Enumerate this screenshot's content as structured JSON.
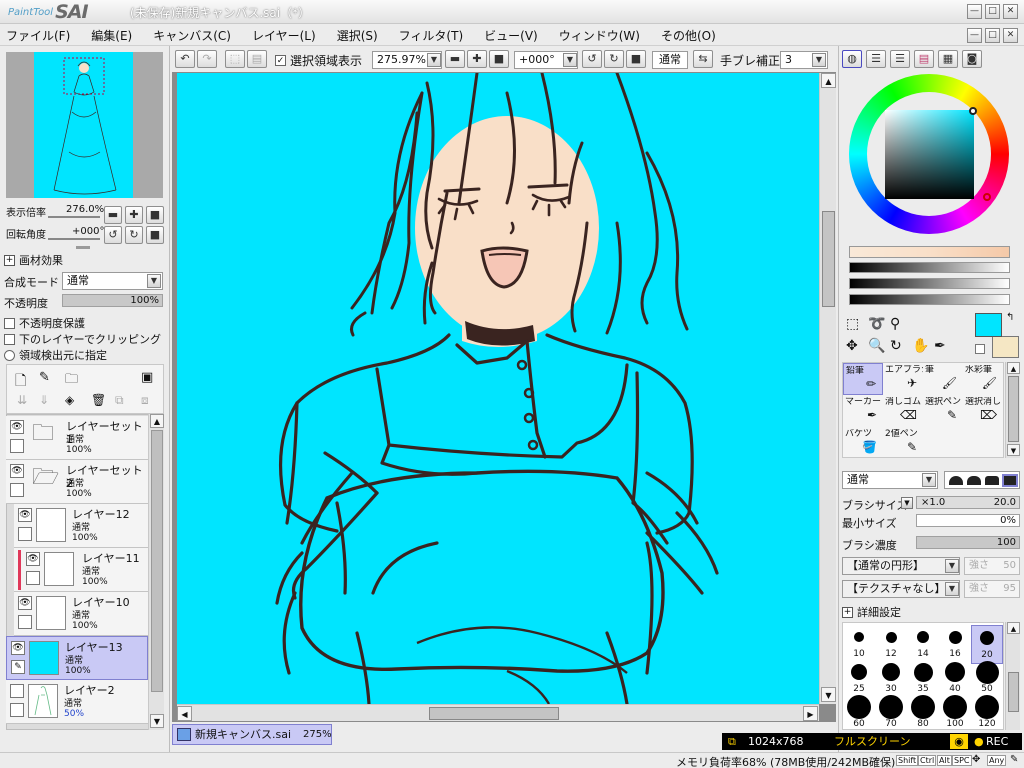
{
  "window": {
    "logo_small": "PaintTool",
    "logo_big": "SAI",
    "title": "(未保存)新規キャンバス.sai（*）",
    "controls": [
      "—",
      "□",
      "✕"
    ],
    "doc_controls": [
      "—",
      "□",
      "✕"
    ]
  },
  "menu": [
    "ファイル(F)",
    "編集(E)",
    "キャンバス(C)",
    "レイヤー(L)",
    "選択(S)",
    "フィルタ(T)",
    "ビュー(V)",
    "ウィンドウ(W)",
    "その他(O)"
  ],
  "toolbar": {
    "selection_display_label": "選択領域表示",
    "selection_display_checked": true,
    "zoom_value": "275.97%",
    "rotation_value": "+000°",
    "blend_mode": "通常",
    "stabilizer_label": "手ブレ補正",
    "stabilizer_value": "3"
  },
  "navigator": {
    "zoom_label": "表示倍率",
    "zoom_value": "276.0%",
    "angle_label": "回転角度",
    "angle_value": "+000°"
  },
  "layer_panel": {
    "texture_effect_label": "画材効果",
    "blend_label": "合成モード",
    "blend_value": "通常",
    "opacity_label": "不透明度",
    "opacity_value": "100%",
    "options": [
      "不透明度保護",
      "下のレイヤーでクリッピング",
      "領域検出元に指定"
    ],
    "layers": [
      {
        "name": "レイヤーセット1",
        "mode": "通常",
        "opacity": "100%",
        "type": "folder"
      },
      {
        "name": "レイヤーセット2",
        "mode": "通常",
        "opacity": "100%",
        "type": "folder-open"
      },
      {
        "name": "レイヤー12",
        "mode": "通常",
        "opacity": "100%",
        "type": "layer"
      },
      {
        "name": "レイヤー11",
        "mode": "通常",
        "opacity": "100%",
        "type": "layer"
      },
      {
        "name": "レイヤー10",
        "mode": "通常",
        "opacity": "100%",
        "type": "layer"
      },
      {
        "name": "レイヤー13",
        "mode": "通常",
        "opacity": "100%",
        "type": "layer-selected"
      },
      {
        "name": "レイヤー2",
        "mode": "通常",
        "opacity": "50%",
        "type": "layer-sketch"
      }
    ]
  },
  "tab": {
    "name": "新規キャンバス.sai",
    "zoom": "275%"
  },
  "color": {
    "primary": "#00e5ff",
    "secondary": "#f5e7c4",
    "skin": "#f9dfc8",
    "line": "#3a2420"
  },
  "tools": [
    {
      "label": "鉛筆",
      "icon": "pencil-icon"
    },
    {
      "label": "エアブラシ",
      "icon": "airbrush-icon"
    },
    {
      "label": "筆",
      "icon": "brush-icon"
    },
    {
      "label": "水彩筆",
      "icon": "watercolor-icon"
    },
    {
      "label": "マーカー",
      "icon": "marker-icon"
    },
    {
      "label": "消しゴム",
      "icon": "eraser-icon"
    },
    {
      "label": "選択ペン",
      "icon": "select-pen-icon"
    },
    {
      "label": "選択消し",
      "icon": "select-erase-icon"
    },
    {
      "label": "バケツ",
      "icon": "bucket-icon"
    },
    {
      "label": "2値ペン",
      "icon": "binary-pen-icon"
    }
  ],
  "brush": {
    "mode": "通常",
    "size_label": "ブラシサイズ",
    "size_multiplier": "×1.0",
    "size_value": "20.0",
    "min_size_label": "最小サイズ",
    "min_size_value": "0%",
    "density_label": "ブラシ濃度",
    "density_value": "100",
    "shape": "【通常の円形】",
    "shape_strength_label": "強さ",
    "shape_strength": "50",
    "texture": "【テクスチャなし】",
    "texture_strength_label": "強さ",
    "texture_strength": "95",
    "detail_label": "詳細設定",
    "sizes": [
      "10",
      "12",
      "14",
      "16",
      "20",
      "25",
      "30",
      "35",
      "40",
      "50",
      "60",
      "70",
      "80",
      "100",
      "120"
    ],
    "selected_size": "20"
  },
  "status": {
    "memory": "メモリ負荷率68% (78MB使用/242MB確保)",
    "keys": [
      "Shift",
      "Ctrl",
      "Alt",
      "SPC"
    ],
    "any": "Any",
    "resolution": "1024x768",
    "fullscreen": "フルスクリーン",
    "rec": "REC"
  }
}
